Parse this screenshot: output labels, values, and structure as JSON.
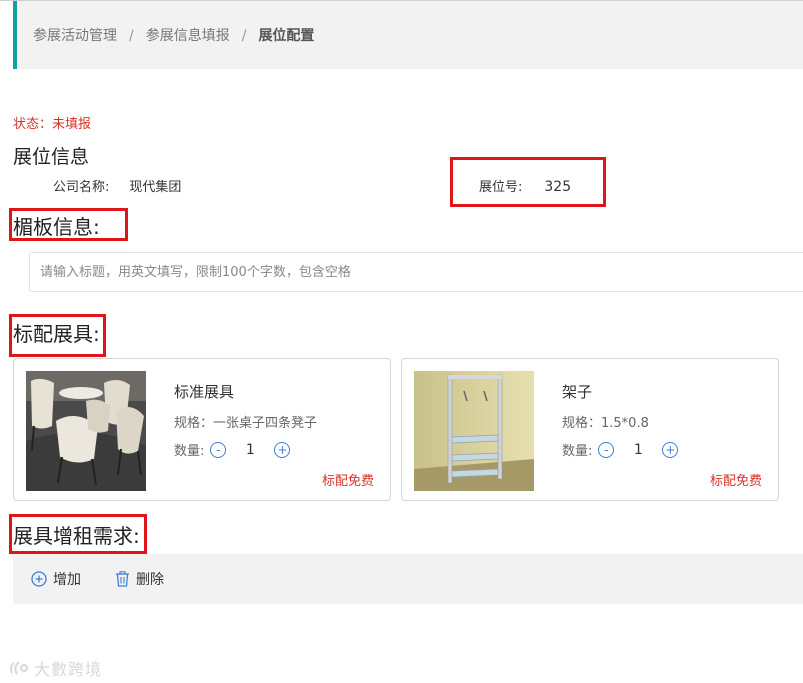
{
  "breadcrumb": {
    "items": [
      "参展活动管理",
      "参展信息填报"
    ],
    "separator": "/",
    "current": "展位配置"
  },
  "status": {
    "label": "状态：",
    "value": "未填报"
  },
  "booth_info": {
    "title": "展位信息",
    "company_label": "公司名称:",
    "company_value": "现代集团",
    "booth_no_label": "展位号:",
    "booth_no_value": "325"
  },
  "fascia": {
    "title": "楣板信息:",
    "placeholder": "请输入标题，用英文填写，限制100个字数，包含空格"
  },
  "standard": {
    "title": "标配展具:",
    "items": [
      {
        "name": "标准展具",
        "spec": "规格：一张桌子四条凳子",
        "qty_label": "数量:",
        "qty": "1",
        "minus": "-",
        "plus": "+",
        "free": "标配免费"
      },
      {
        "name": "架子",
        "spec": "规格：1.5*0.8",
        "qty_label": "数量:",
        "qty": "1",
        "minus": "-",
        "plus": "+",
        "free": "标配免费"
      }
    ]
  },
  "rental": {
    "title": "展具增租需求:",
    "add_label": "增加",
    "delete_label": "删除"
  },
  "watermark": {
    "text": "大數跨境"
  },
  "colors": {
    "accent": "#14a0a0",
    "highlight": "#e0151b",
    "status": "#d9322b",
    "primary": "#3d7fd6"
  }
}
